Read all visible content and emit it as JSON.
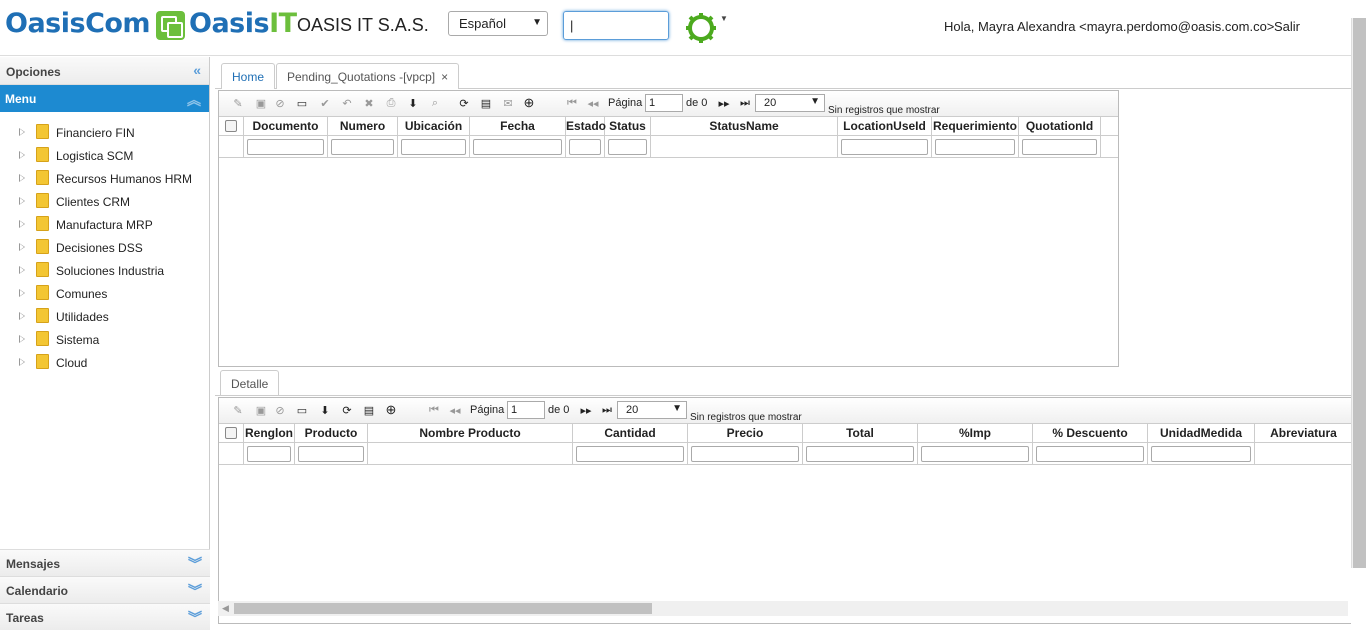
{
  "header": {
    "logo1": "OasisCom",
    "logo2_a": "Oasis",
    "logo2_b": "IT",
    "company": "OASIS IT S.A.S.",
    "language": "Español",
    "search_value": "|",
    "greeting": "Hola, Mayra Alexandra <mayra.perdomo@oasis.com.co>",
    "logout": "Salir",
    "accent": "#1d8ad1",
    "brand_green": "#6cbf3c"
  },
  "sidebar": {
    "options_title": "Opciones",
    "menu_title": "Menu",
    "items": [
      {
        "label": "Financiero FIN"
      },
      {
        "label": "Logistica SCM"
      },
      {
        "label": "Recursos Humanos HRM"
      },
      {
        "label": "Clientes CRM"
      },
      {
        "label": "Manufactura MRP"
      },
      {
        "label": "Decisiones DSS"
      },
      {
        "label": "Soluciones Industria"
      },
      {
        "label": "Comunes"
      },
      {
        "label": "Utilidades"
      },
      {
        "label": "Sistema"
      },
      {
        "label": "Cloud"
      }
    ],
    "accordions": [
      {
        "label": "Mensajes"
      },
      {
        "label": "Calendario"
      },
      {
        "label": "Tareas"
      }
    ]
  },
  "tabs": [
    {
      "label": "Home"
    },
    {
      "label": "Pending_Quotations -[vpcp]",
      "close": "×"
    }
  ],
  "grid1": {
    "pager": {
      "page_label": "Página",
      "page_value": "1",
      "of_label": "de 0",
      "rows": "20",
      "norecords": "Sin registros que mostrar"
    },
    "columns": [
      "Documento",
      "Numero",
      "Ubicación",
      "Fecha",
      "Estado",
      "Status",
      "StatusName",
      "LocationUseId",
      "Requerimiento",
      "QuotationId"
    ]
  },
  "detail_tab": "Detalle",
  "grid2": {
    "pager": {
      "page_label": "Página",
      "page_value": "1",
      "of_label": "de 0",
      "rows": "20",
      "norecords": "Sin registros que mostrar"
    },
    "columns": [
      "Renglon",
      "Producto",
      "Nombre Producto",
      "Cantidad",
      "Precio",
      "Total",
      "%Imp",
      "% Descuento",
      "UnidadMedida",
      "Abreviatura"
    ]
  },
  "icons": [
    "edit-icon",
    "save-icon",
    "cancel-icon",
    "link-icon",
    "check-icon",
    "undo-icon",
    "delete-icon",
    "print-icon",
    "download-icon",
    "search-icon",
    "refresh-icon",
    "comment-icon",
    "mail-icon",
    "add-icon"
  ]
}
